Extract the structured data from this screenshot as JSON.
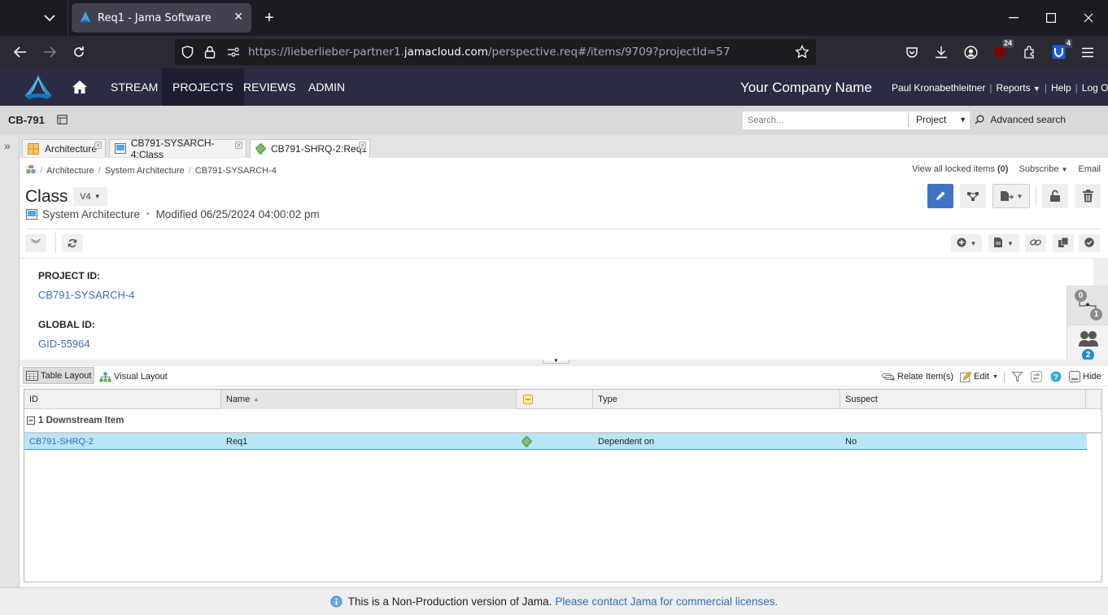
{
  "browser": {
    "tab_title": "Req1 - Jama Software",
    "url_prefix": "https://lieberlieber-partner1.",
    "url_domain": "jamacloud.com",
    "url_path": "/perspective.req#/items/9709?projectId=57",
    "ublock_badge": "24",
    "bitwarden_badge": "4"
  },
  "jama": {
    "nav": [
      {
        "label": "STREAM"
      },
      {
        "label": "PROJECTS",
        "active": true
      },
      {
        "label": "REVIEWS"
      },
      {
        "label": "ADMIN"
      }
    ],
    "company": "Your Company Name",
    "user": "Paul Kronabethleitner",
    "reports": "Reports",
    "help": "Help",
    "logout": "Log Out"
  },
  "project_bar": {
    "project_id": "CB-791",
    "search_placeholder": "Search...",
    "scope": "Project",
    "advanced_search": "Advanced search"
  },
  "item_tabs": [
    {
      "label": "Architecture",
      "icon": "folder-icon"
    },
    {
      "label": "CB791-SYSARCH-4:Class",
      "icon": "class-icon"
    },
    {
      "label": "CB791-SHRQ-2:Req1",
      "icon": "puzzle-icon",
      "active": true
    }
  ],
  "item": {
    "breadcrumb": [
      "Architecture",
      "System Architecture",
      "CB791-SYSARCH-4"
    ],
    "view_locked": "View all locked items",
    "locked_count": "(0)",
    "subscribe": "Subscribe",
    "email": "Email",
    "title": "Class",
    "version": "V4",
    "item_type": "System Architecture",
    "bullet": "•",
    "modified": "Modified 06/25/2024 04:00:02 pm",
    "fields": [
      {
        "label": "PROJECT ID:",
        "value": "CB791-SYSARCH-4"
      },
      {
        "label": "GLOBAL ID:",
        "value": "GID-55964"
      }
    ],
    "rail": {
      "relationships_up": "0",
      "relationships_down": "1",
      "collaborators": "2"
    }
  },
  "relationships": {
    "table_layout": "Table Layout",
    "visual_layout": "Visual Layout",
    "relate_items": "Relate Item(s)",
    "edit": "Edit",
    "hide": "Hide",
    "columns": [
      "ID",
      "Name",
      "",
      "Type",
      "Suspect"
    ],
    "group_label": "1 Downstream Item",
    "rows": [
      {
        "id": "CB791-SHRQ-2",
        "name": "Req1",
        "type": "Dependent on",
        "suspect": "No"
      }
    ]
  },
  "footer": {
    "text": "This is a Non-Production version of Jama.",
    "link": "Please contact Jama for commercial licenses."
  },
  "colors": {
    "jama_header": "#2b2c43",
    "accent_blue": "#3a6fb8",
    "row_selected": "#b8e6f6",
    "edit_button": "#3f73c8"
  }
}
